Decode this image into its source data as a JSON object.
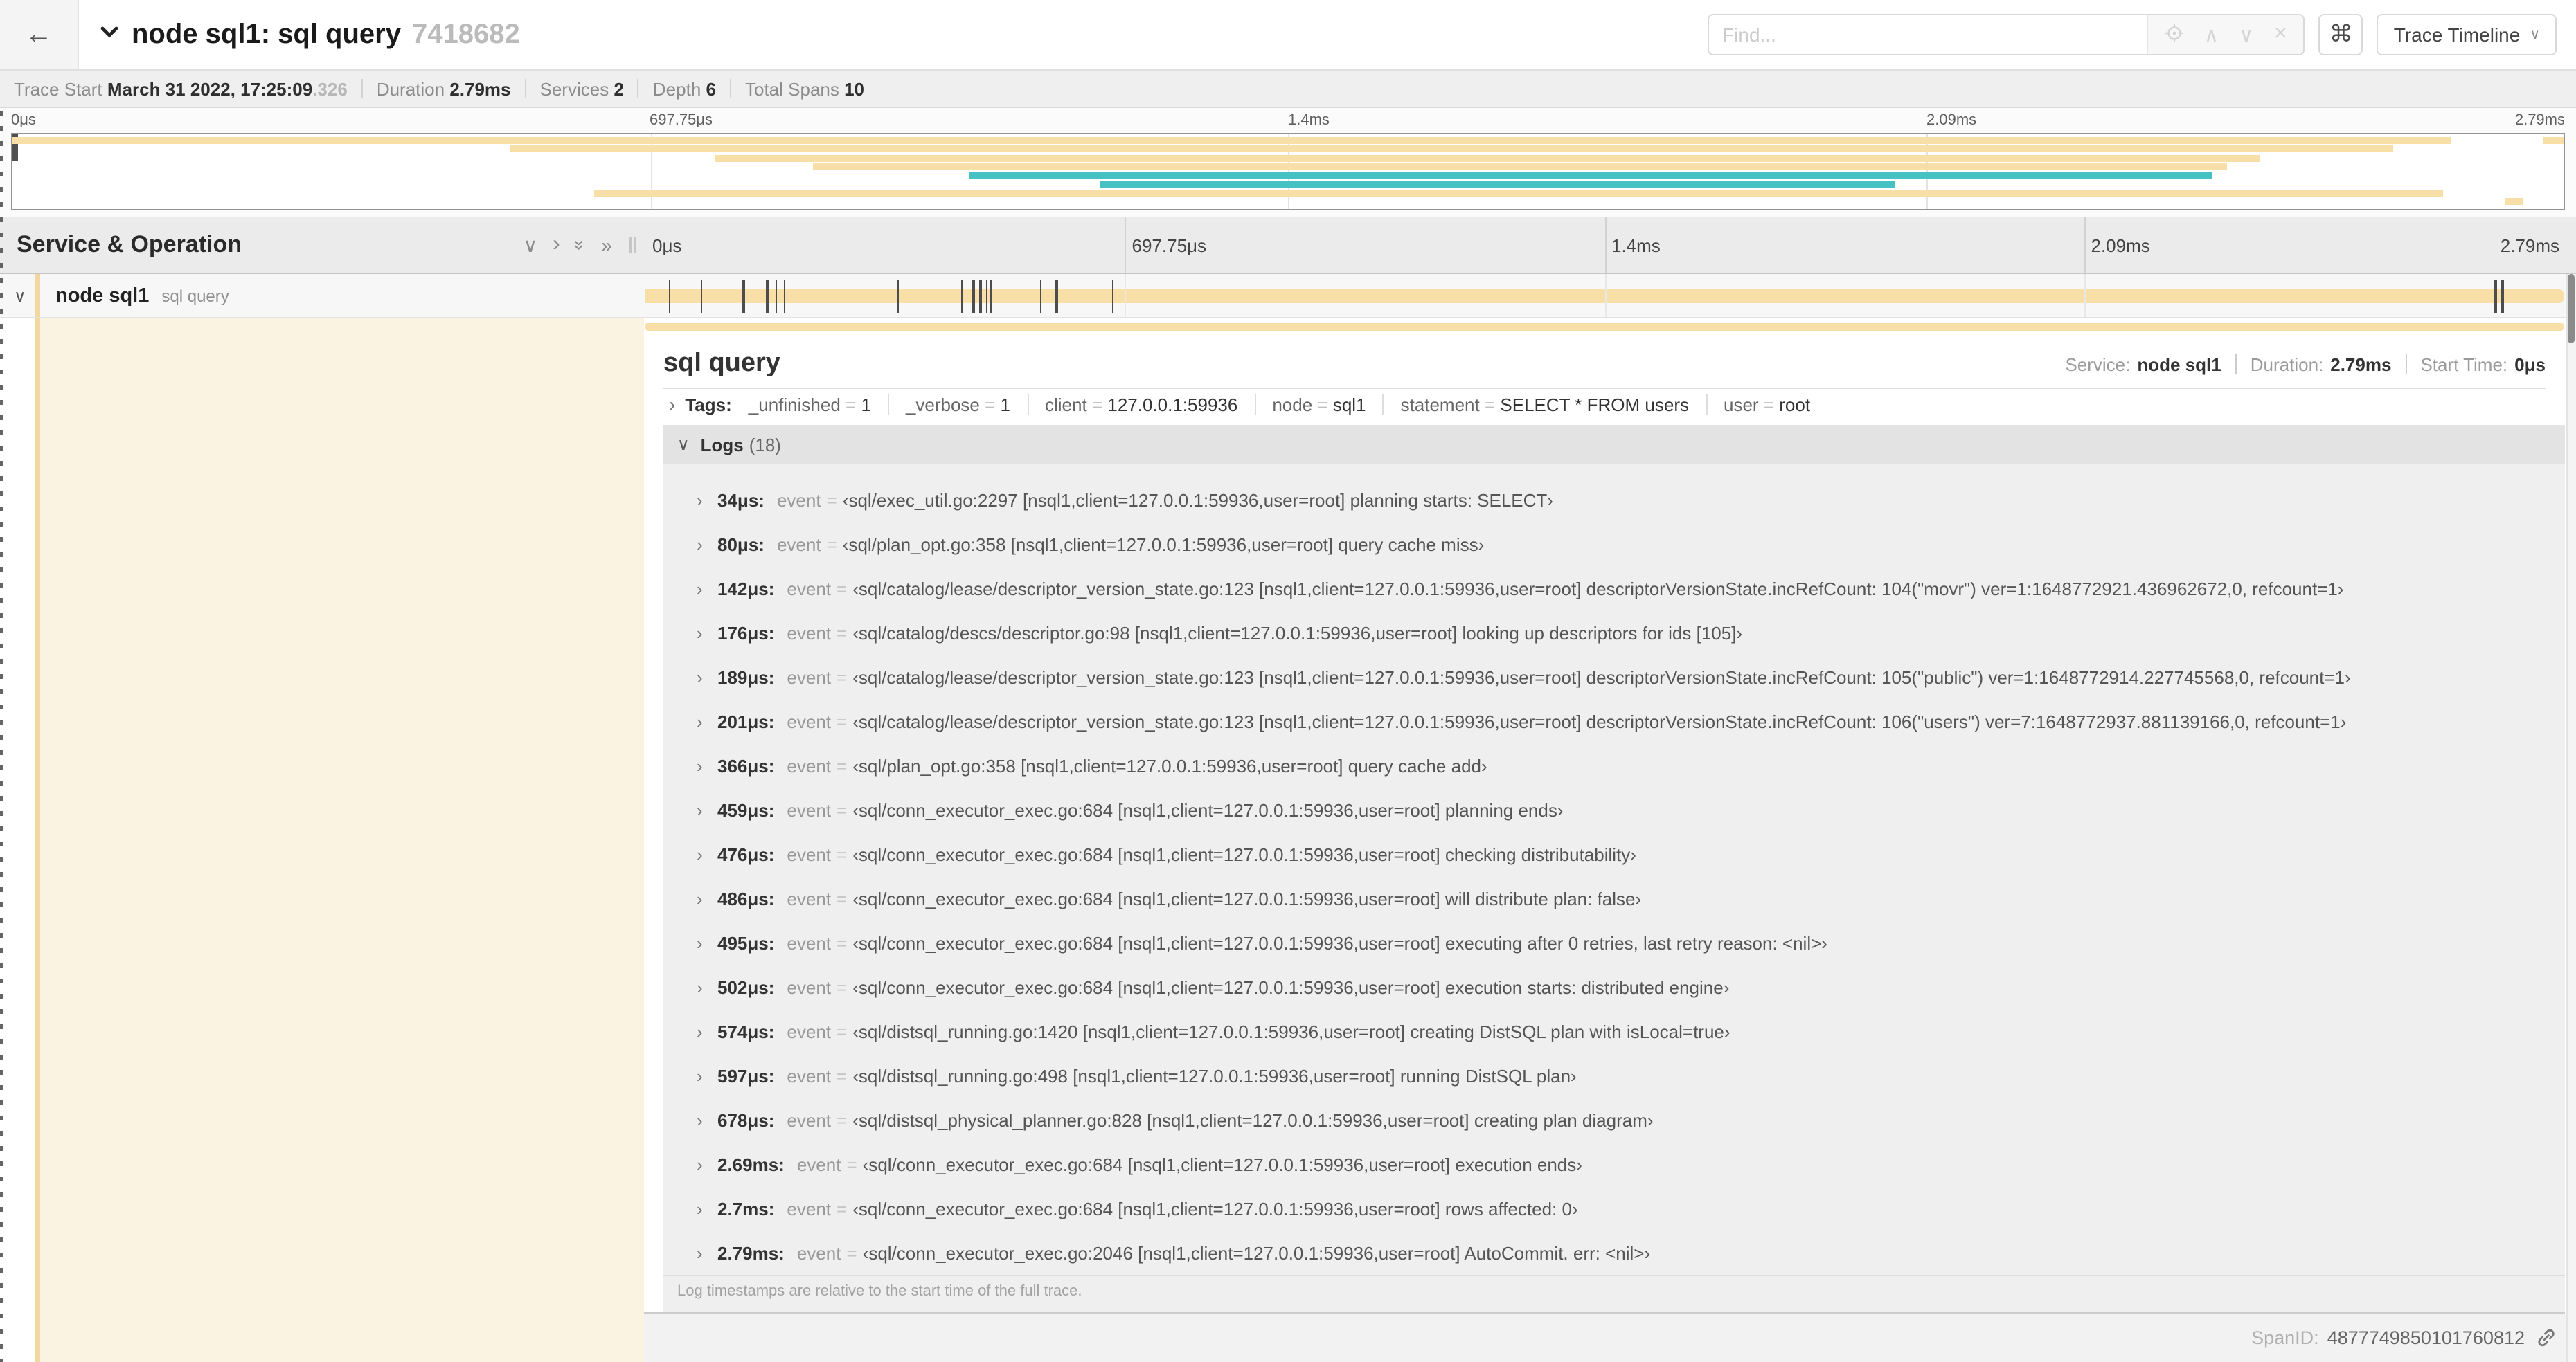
{
  "icons": {
    "back": "←",
    "collapse": "∨",
    "expand": "›",
    "expand_all": "»",
    "up": "∧",
    "down": "∨",
    "clear": "×",
    "shortcut": "⌘",
    "locate": "crosshair-circle",
    "link": "chain-link",
    "grip": "column-resizer"
  },
  "colors": {
    "span_bar": "#F8DFA8",
    "span_accent": "#F2D8A0",
    "span_cream": "#FBF3E1",
    "highlight": "#46C2C5",
    "tick": "#4d4d4d"
  },
  "header": {
    "title": "node sql1: sql query",
    "trace_id": "7418682",
    "find_placeholder": "Find...",
    "view_button": "Trace Timeline"
  },
  "summary": {
    "items": [
      {
        "label": "Trace Start",
        "value": "March 31 2022, 17:25:09",
        "suffix": ".326"
      },
      {
        "label": "Duration",
        "value": "2.79ms"
      },
      {
        "label": "Services",
        "value": "2"
      },
      {
        "label": "Depth",
        "value": "6"
      },
      {
        "label": "Total Spans",
        "value": "10"
      }
    ]
  },
  "minimap": {
    "time_labels": [
      "0μs",
      "697.75μs",
      "1.4ms",
      "2.09ms",
      "2.79ms"
    ],
    "bars": [
      {
        "row": 0,
        "start": 0,
        "end": 95.6,
        "color": "span"
      },
      {
        "row": 0,
        "start": 99.2,
        "end": 100,
        "color": "span"
      },
      {
        "row": 1,
        "start": 19.5,
        "end": 93.3,
        "color": "span"
      },
      {
        "row": 2,
        "start": 27.5,
        "end": 88.1,
        "color": "span"
      },
      {
        "row": 3,
        "start": 31.4,
        "end": 86.8,
        "color": "span"
      },
      {
        "row": 4,
        "start": 37.5,
        "end": 86.2,
        "color": "highlight"
      },
      {
        "row": 5,
        "start": 42.6,
        "end": 73.8,
        "color": "highlight"
      },
      {
        "row": 6,
        "start": 22.8,
        "end": 95.3,
        "color": "span"
      },
      {
        "row": 7,
        "start": 97.7,
        "end": 98.4,
        "color": "span"
      }
    ]
  },
  "timeline": {
    "column_header": "Service & Operation",
    "axis_labels": [
      "0μs",
      "697.75μs",
      "1.4ms",
      "2.09ms",
      "2.79ms"
    ],
    "total_duration_us": 2790,
    "row": {
      "service": "node sql1",
      "operation": "sql query"
    }
  },
  "detail": {
    "operation": "sql query",
    "meta": [
      {
        "label": "Service:",
        "value": "node sql1"
      },
      {
        "label": "Duration:",
        "value": "2.79ms"
      },
      {
        "label": "Start Time:",
        "value": "0μs"
      }
    ],
    "tags_label": "Tags:",
    "tags": [
      {
        "key": "_unfinished",
        "value": "1"
      },
      {
        "key": "_verbose",
        "value": "1"
      },
      {
        "key": "client",
        "value": "127.0.0.1:59936"
      },
      {
        "key": "node",
        "value": "sql1"
      },
      {
        "key": "statement",
        "value": "SELECT * FROM users"
      },
      {
        "key": "user",
        "value": "root"
      }
    ],
    "logs_label": "Logs",
    "logs_count": "(18)",
    "logs": [
      {
        "time": "34μs:",
        "time_us": 34,
        "field": "event",
        "value": "‹sql/exec_util.go:2297 [nsql1,client=127.0.0.1:59936,user=root] planning starts: SELECT›"
      },
      {
        "time": "80μs:",
        "time_us": 80,
        "field": "event",
        "value": "‹sql/plan_opt.go:358 [nsql1,client=127.0.0.1:59936,user=root] query cache miss›"
      },
      {
        "time": "142μs:",
        "time_us": 142,
        "field": "event",
        "value": "‹sql/catalog/lease/descriptor_version_state.go:123 [nsql1,client=127.0.0.1:59936,user=root] descriptorVersionState.incRefCount: 104(\"movr\") ver=1:1648772921.436962672,0, refcount=1›"
      },
      {
        "time": "176μs:",
        "time_us": 176,
        "field": "event",
        "value": "‹sql/catalog/descs/descriptor.go:98 [nsql1,client=127.0.0.1:59936,user=root] looking up descriptors for ids [105]›"
      },
      {
        "time": "189μs:",
        "time_us": 189,
        "field": "event",
        "value": "‹sql/catalog/lease/descriptor_version_state.go:123 [nsql1,client=127.0.0.1:59936,user=root] descriptorVersionState.incRefCount: 105(\"public\") ver=1:1648772914.227745568,0, refcount=1›"
      },
      {
        "time": "201μs:",
        "time_us": 201,
        "field": "event",
        "value": "‹sql/catalog/lease/descriptor_version_state.go:123 [nsql1,client=127.0.0.1:59936,user=root] descriptorVersionState.incRefCount: 106(\"users\") ver=7:1648772937.881139166,0, refcount=1›"
      },
      {
        "time": "366μs:",
        "time_us": 366,
        "field": "event",
        "value": "‹sql/plan_opt.go:358 [nsql1,client=127.0.0.1:59936,user=root] query cache add›"
      },
      {
        "time": "459μs:",
        "time_us": 459,
        "field": "event",
        "value": "‹sql/conn_executor_exec.go:684 [nsql1,client=127.0.0.1:59936,user=root] planning ends›"
      },
      {
        "time": "476μs:",
        "time_us": 476,
        "field": "event",
        "value": "‹sql/conn_executor_exec.go:684 [nsql1,client=127.0.0.1:59936,user=root] checking distributability›"
      },
      {
        "time": "486μs:",
        "time_us": 486,
        "field": "event",
        "value": "‹sql/conn_executor_exec.go:684 [nsql1,client=127.0.0.1:59936,user=root] will distribute plan: false›"
      },
      {
        "time": "495μs:",
        "time_us": 495,
        "field": "event",
        "value": "‹sql/conn_executor_exec.go:684 [nsql1,client=127.0.0.1:59936,user=root] executing after 0 retries, last retry reason: <nil>›"
      },
      {
        "time": "502μs:",
        "time_us": 502,
        "field": "event",
        "value": "‹sql/conn_executor_exec.go:684 [nsql1,client=127.0.0.1:59936,user=root] execution starts: distributed engine›"
      },
      {
        "time": "574μs:",
        "time_us": 574,
        "field": "event",
        "value": "‹sql/distsql_running.go:1420 [nsql1,client=127.0.0.1:59936,user=root] creating DistSQL plan with isLocal=true›"
      },
      {
        "time": "597μs:",
        "time_us": 597,
        "field": "event",
        "value": "‹sql/distsql_running.go:498 [nsql1,client=127.0.0.1:59936,user=root] running DistSQL plan›"
      },
      {
        "time": "678μs:",
        "time_us": 678,
        "field": "event",
        "value": "‹sql/distsql_physical_planner.go:828 [nsql1,client=127.0.0.1:59936,user=root] creating plan diagram›"
      },
      {
        "time": "2.69ms:",
        "time_us": 2690,
        "field": "event",
        "value": "‹sql/conn_executor_exec.go:684 [nsql1,client=127.0.0.1:59936,user=root] execution ends›"
      },
      {
        "time": "2.7ms:",
        "time_us": 2700,
        "field": "event",
        "value": "‹sql/conn_executor_exec.go:684 [nsql1,client=127.0.0.1:59936,user=root] rows affected: 0›"
      },
      {
        "time": "2.79ms:",
        "time_us": 2790,
        "field": "event",
        "value": "‹sql/conn_executor_exec.go:2046 [nsql1,client=127.0.0.1:59936,user=root] AutoCommit. err: <nil>›"
      }
    ],
    "footer_note": "Log timestamps are relative to the start time of the full trace.",
    "span_id_label": "SpanID:",
    "span_id": "4877749850101760812"
  }
}
